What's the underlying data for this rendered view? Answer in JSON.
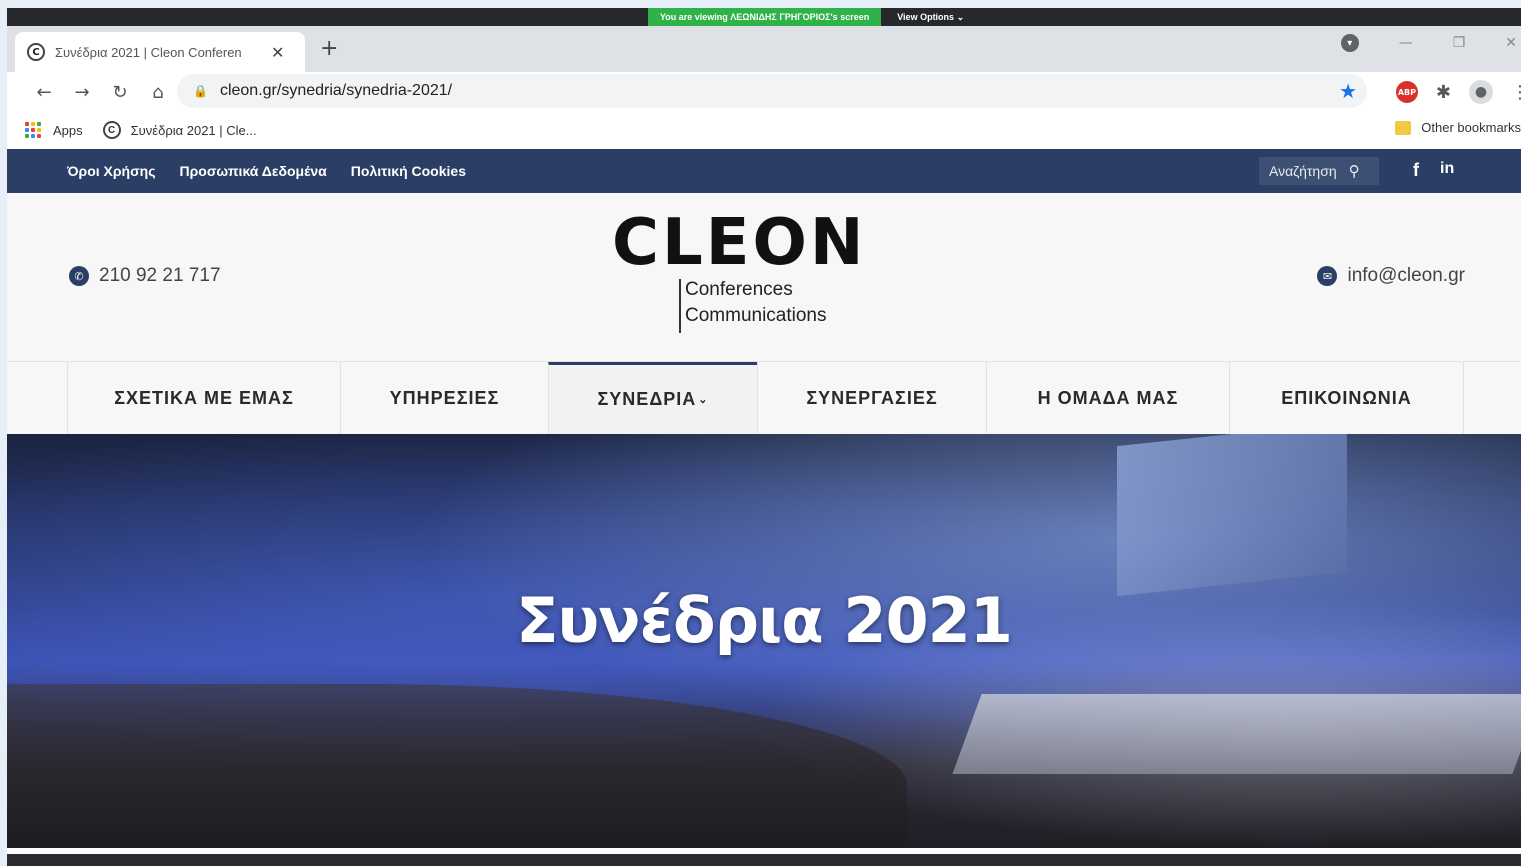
{
  "screen_share": {
    "message": "You are viewing ΛΕΩΝΙΔΗΣ ΓΡΗΓΟΡΙΟΣ's screen",
    "options_label": "View Options ⌄"
  },
  "browser": {
    "tab_title": "Συνέδρια 2021 | Cleon Conferen",
    "tab_favicon": "C",
    "new_tab": "+",
    "url": "cleon.gr/synedria/synedria-2021/",
    "extension_abp": "ABP",
    "bookmarks": {
      "apps_label": "Apps",
      "site_label": "Συνέδρια 2021 | Cle...",
      "other_label": "Other bookmarks"
    },
    "icons": {
      "back": "←",
      "forward": "→",
      "reload": "↻",
      "home": "⌂",
      "lock": "🔒",
      "star": "★",
      "puzzle": "✱",
      "menu": "⋮",
      "close": "✕",
      "minimize": "—",
      "restore": "❐",
      "win_close": "✕",
      "tab_search": "▾",
      "profile": "●"
    },
    "accent_color": "#1a73e8"
  },
  "site": {
    "brand_color": "#2b3e65",
    "top_links": [
      "Όροι Χρήσης",
      "Προσωπικά Δεδομένα",
      "Πολιτική Cookies"
    ],
    "search_label": "Αναζήτηση",
    "social": {
      "facebook": "f",
      "linkedin": "in"
    },
    "phone": "210 92 21 717",
    "email": "info@cleon.gr",
    "logo": {
      "word": "CLEON",
      "line1": "Conferences",
      "line2": "Communications"
    },
    "nav": [
      {
        "label": "ΣΧΕΤΙΚΑ ΜΕ ΕΜΑΣ"
      },
      {
        "label": "ΥΠΗΡΕΣΙΕΣ"
      },
      {
        "label": "ΣΥΝΕΔΡΙΑ",
        "active": true,
        "has_dropdown": true
      },
      {
        "label": "ΣΥΝΕΡΓΑΣΙΕΣ"
      },
      {
        "label": "Η ΟΜΑΔΑ ΜΑΣ"
      },
      {
        "label": "ΕΠΙΚΟΙΝΩΝΙΑ"
      }
    ],
    "hero_title": "Συνέδρια 2021"
  }
}
